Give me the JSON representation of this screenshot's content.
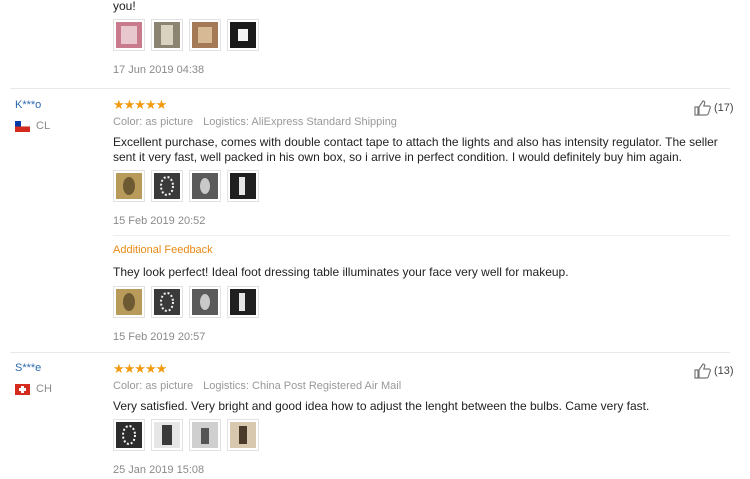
{
  "top_fragment": "you!",
  "top_date": "17 Jun 2019 04:38",
  "reviews": [
    {
      "user": "K***o",
      "country": "CL",
      "stars": "★★★★★",
      "color": "Color: as picture",
      "logistics": "Logistics: AliExpress Standard Shipping",
      "likes": "(17)",
      "text": "Excellent purchase, comes with double contact tape to attach the lights and also has intensity regulator. The seller sent it very fast, well packed in his own box, so i arrive in perfect condition. I would definitely buy him again.",
      "date": "15 Feb 2019 20:52",
      "additional_label": "Additional Feedback",
      "additional_text": "They look perfect! Ideal foot dressing table illuminates your face very well for makeup.",
      "additional_date": "15 Feb 2019 20:57"
    },
    {
      "user": "S***e",
      "country": "CH",
      "stars": "★★★★★",
      "color": "Color: as picture",
      "logistics": "Logistics: China Post Registered Air Mail",
      "likes": "(13)",
      "text": "Very satisfied. Very bright and good idea how to adjust the lenght between the bulbs. Came very fast.",
      "date": "25 Jan 2019 15:08"
    }
  ],
  "colors": {
    "star": "#f29b11",
    "username": "#2a6ab0",
    "additional": "#e88a18"
  }
}
